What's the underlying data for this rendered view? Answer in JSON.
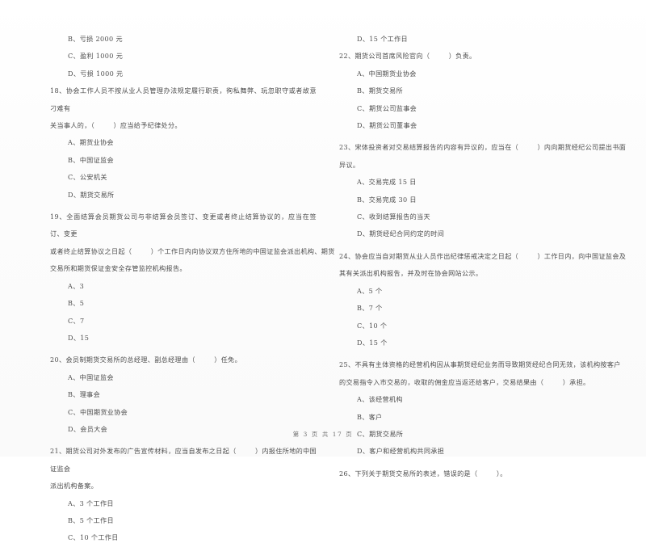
{
  "document": {
    "title": "期货法律法规 单项选择题 试卷",
    "page_footer": "第 3 页 共 17 页",
    "page_number": "3",
    "total_pages": "17",
    "text_color": "#4d4d4d",
    "background_color": "#fdfdfd"
  },
  "left_column": {
    "orphan_options": [
      "B、亏损 2000 元",
      "C、盈利 1000 元",
      "D、亏损 1000 元"
    ],
    "questions": [
      {
        "number": "18",
        "stem_lines": [
          "18、协会工作人员不按从业人员管理办法规定履行职责，徇私舞弊、玩忽职守或者故意刁难有",
          "关当事人的，（        ）应当给予纪律处分。"
        ],
        "options": [
          "A、期货业协会",
          "B、中国证监会",
          "C、公安机关",
          "D、期货交易所"
        ]
      },
      {
        "number": "19",
        "stem_lines": [
          "19、全面结算会员期货公司与非结算会员签订、变更或者终止结算协议的，应当在签订、变更",
          "或者终止结算协议之日起（        ）个工作日内向协议双方住所地的中国证监会派出机构、期货",
          "交易所和期货保证金安全存管监控机构报告。"
        ],
        "options": [
          "A、3",
          "B、5",
          "C、7",
          "D、15"
        ]
      },
      {
        "number": "20",
        "stem_lines": [
          "20、会员制期货交易所的总经理、副总经理由（        ）任免。"
        ],
        "options": [
          "A、中国证监会",
          "B、理事会",
          "C、中国期货业协会",
          "D、会员大会"
        ]
      },
      {
        "number": "21",
        "stem_lines": [
          "21、期货公司对外发布的广告宣传材料，应当自发布之日起（        ）内报住所地的中国证监会",
          "派出机构备案。"
        ],
        "options": [
          "A、3 个工作日",
          "B、5 个工作日",
          "C、10 个工作日"
        ]
      }
    ]
  },
  "right_column": {
    "orphan_options": [
      "D、15 个工作日"
    ],
    "questions": [
      {
        "number": "22",
        "stem_lines": [
          "22、期货公司首席风险官向（        ）负责。"
        ],
        "options": [
          "A、中国期货业协会",
          "B、期货交易所",
          "C、期货公司监事会",
          "D、期货公司董事会"
        ]
      },
      {
        "number": "23",
        "stem_lines": [
          "23、宋体投资者对交易结算报告的内容有异议的，应当在（        ）内向期货经纪公司提出书面",
          "异议。"
        ],
        "options": [
          "A、交易完成 15 日",
          "B、交易完成 30 日",
          "C、收到结算报告的当天",
          "D、期货经纪合同约定的时间"
        ]
      },
      {
        "number": "24",
        "stem_lines": [
          "24、协会应当自对期货从业人员作出纪律惩戒决定之日起（        ）工作日内，向中国证监会及",
          "其有关派出机构报告，并及时在协会网站公示。"
        ],
        "options": [
          "A、5 个",
          "B、7 个",
          "C、10 个",
          "D、15 个"
        ]
      },
      {
        "number": "25",
        "stem_lines": [
          "25、不具有主体资格的经营机构因从事期货经纪业务而导致期货经纪合同无效，该机构按客户",
          "的交易指令入市交易的，收取的佣金应当返还给客户，交易结果由（        ）承担。"
        ],
        "options": [
          "A、该经营机构",
          "B、客户",
          "C、期货交易所",
          "D、客户和经营机构共同承担"
        ]
      },
      {
        "number": "26",
        "stem_lines": [
          "26、下列关于期货交易所的表述，错误的是（        ）。"
        ],
        "options": []
      }
    ]
  }
}
